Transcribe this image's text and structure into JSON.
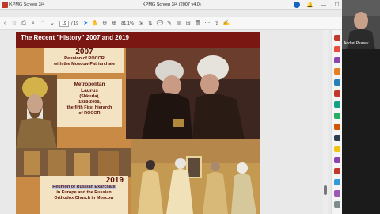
{
  "titlebar": {
    "tab_label": "KPMG Screen 3/4",
    "window_title": "KPMG Screen 3/4 (2007 v4.0)"
  },
  "toolbar": {
    "page_current": "19",
    "page_total": "/ 19",
    "zoom": "81.1%"
  },
  "video": {
    "participant_name": "Andrei Psarev"
  },
  "slide": {
    "title": "The Recent \"History\" 2007 and 2019",
    "block1": {
      "year": "2007",
      "line1": "Reunion of ROCOR",
      "line2": "with the Moscow Patriarchate"
    },
    "block2": {
      "line1": "Metropolitan",
      "line2": "Laurus",
      "line3": "(Shkurla),",
      "line4": "1928-2008,",
      "line5": "the fifth First hierarch",
      "line6": "of ROCOR"
    },
    "block3": {
      "year": "2019",
      "line1": "Reunion of Russian Exarchate",
      "line2": "in Europe and the Russian",
      "line3": "Orthodox Church in Moscow"
    }
  },
  "colors": {
    "slide_header": "#7a1712",
    "slide_bg": "#c88a44",
    "text_box": "#f3e3c2",
    "text_dark_red": "#5a0f0a"
  }
}
